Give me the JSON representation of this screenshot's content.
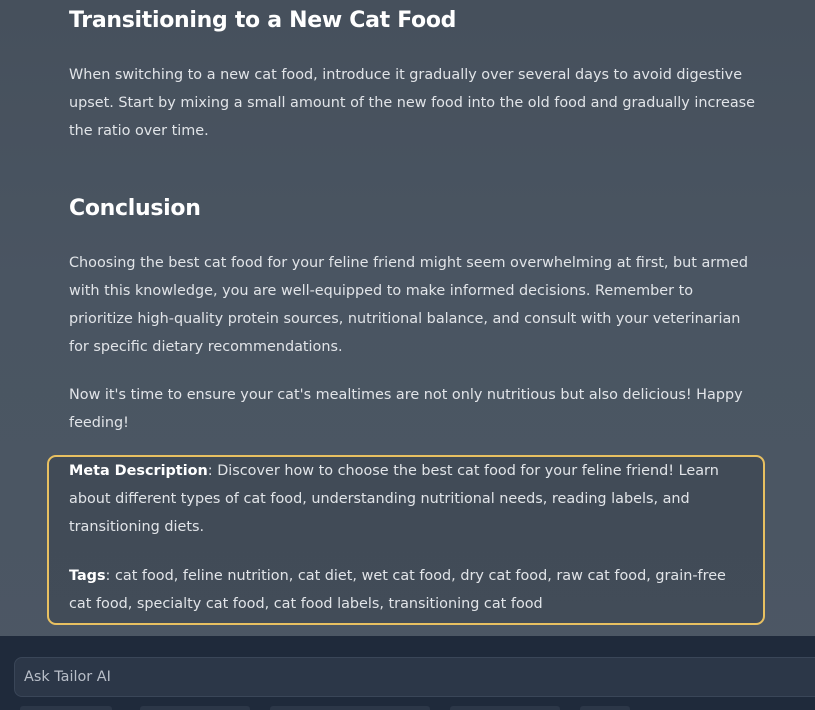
{
  "article": {
    "transition": {
      "heading": "Transitioning to a New Cat Food",
      "body": "When switching to a new cat food, introduce it gradually over several days to avoid digestive upset. Start by mixing a small amount of the new food into the old food and gradually increase the ratio over time."
    },
    "conclusion": {
      "heading": "Conclusion",
      "body": "Choosing the best cat food for your feline friend might seem overwhelming at first, but armed with this knowledge, you are well-equipped to make informed decisions. Remember to prioritize high-quality protein sources, nutritional balance, and consult with your veterinarian for specific dietary recommendations.",
      "closing": "Now it's time to ensure your cat's mealtimes are not only nutritious but also delicious! Happy feeding!"
    }
  },
  "meta": {
    "description_label": "Meta Description",
    "description_text": ": Discover how to choose the best cat food for your feline friend! Learn about different types of cat food, understanding nutritional needs, reading labels, and transitioning diets.",
    "tags_label": "Tags",
    "tags_text": ": cat food, feline nutrition, cat diet, wet cat food, dry cat food, raw cat food, grain-free cat food, specialty cat food, cat food labels, transitioning cat food",
    "highlight_color": "#e8c061"
  },
  "chat": {
    "placeholder": "Ask Tailor AI"
  },
  "colors": {
    "background": "#4a5562",
    "bottom_bar": "#1f2a3b",
    "heading": "#ffffff",
    "body_text": "#e1e4e8"
  }
}
